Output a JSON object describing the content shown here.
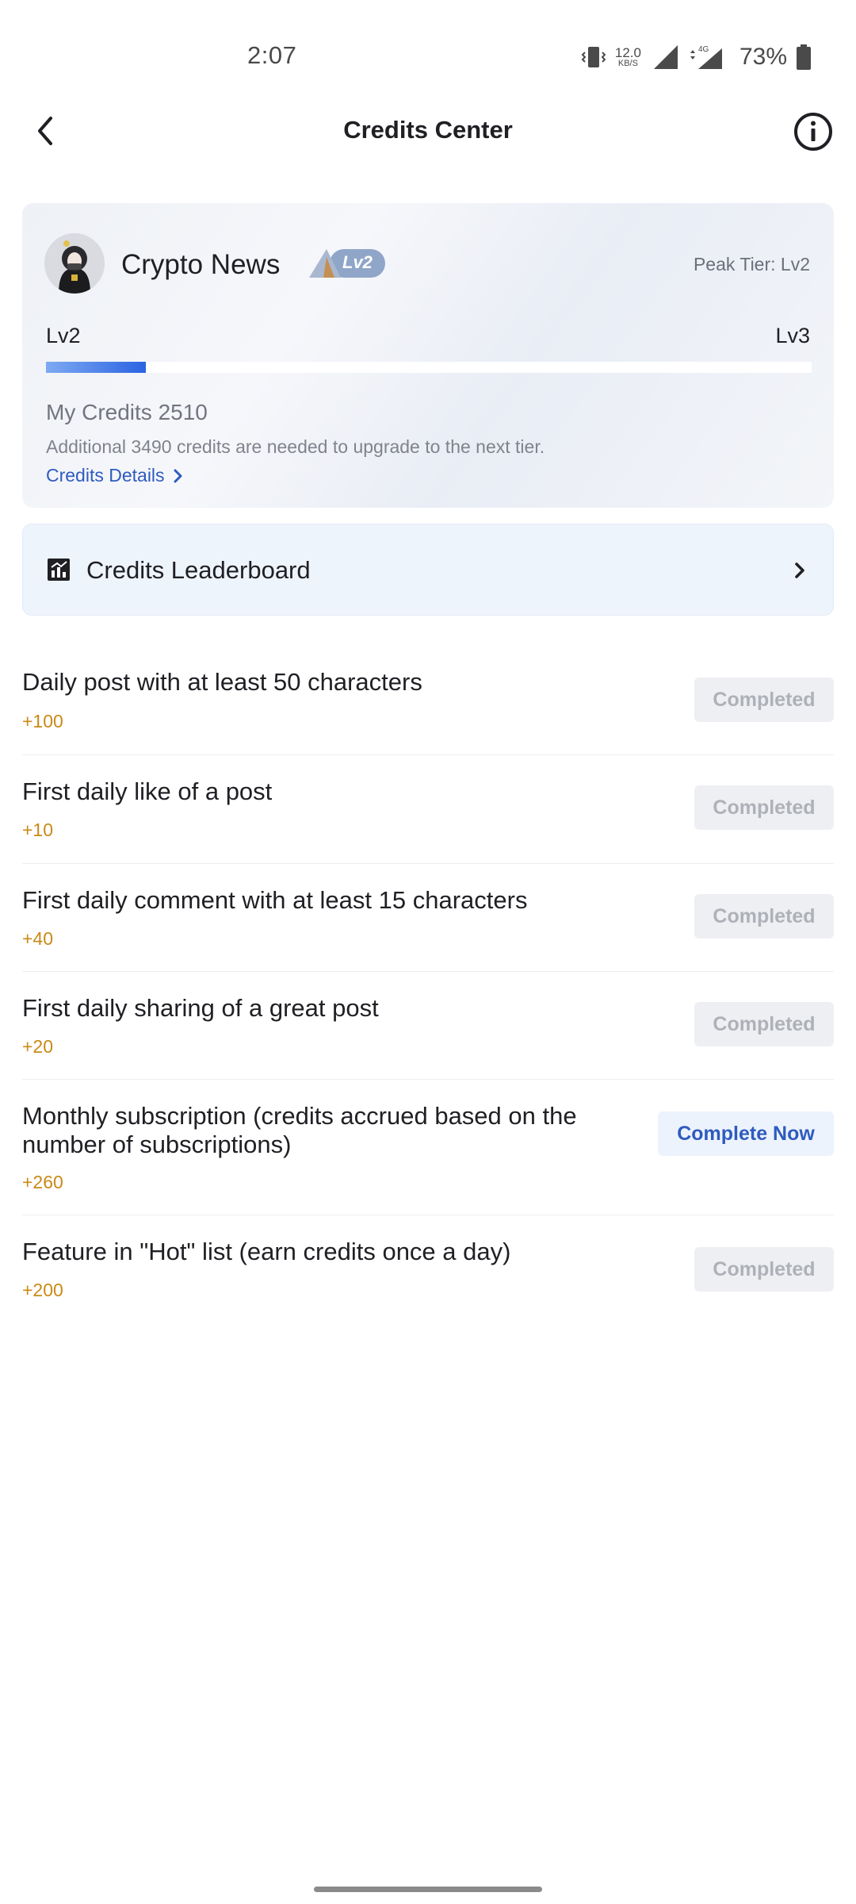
{
  "status_bar": {
    "time": "2:07",
    "net_speed_value": "12.0",
    "net_speed_unit": "KB/S",
    "network_type": "4G",
    "battery_percent": "73%"
  },
  "header": {
    "title": "Credits Center"
  },
  "profile": {
    "username": "Crypto News",
    "level_badge": "Lv2",
    "peak_tier": "Peak Tier: Lv2",
    "current_level": "Lv2",
    "next_level": "Lv3",
    "progress_fraction": 0.13,
    "my_credits": "My Credits 2510",
    "needed_text": "Additional 3490 credits are needed to upgrade to the next tier.",
    "details_link": "Credits Details"
  },
  "leaderboard": {
    "label": "Credits Leaderboard"
  },
  "tasks": [
    {
      "title": "Daily post with at least 50 characters",
      "points": "+100",
      "button": "Completed",
      "state": "completed"
    },
    {
      "title": "First daily like of a post",
      "points": "+10",
      "button": "Completed",
      "state": "completed"
    },
    {
      "title": "First daily comment with at least 15 characters",
      "points": "+40",
      "button": "Completed",
      "state": "completed"
    },
    {
      "title": "First daily sharing of a great post",
      "points": "+20",
      "button": "Completed",
      "state": "completed"
    },
    {
      "title": "Monthly subscription (credits accrued based on the number of subscriptions)",
      "points": "+260",
      "button": "Complete Now",
      "state": "action"
    },
    {
      "title": "Feature in \"Hot\" list (earn credits once a day)",
      "points": "+200",
      "button": "Completed",
      "state": "completed"
    }
  ],
  "colors": {
    "accent": "#2e5bbf",
    "points": "#c98a17",
    "progress_start": "#7eaaf2",
    "progress_end": "#2b63e2",
    "completed_bg": "#eeeff2",
    "completed_text": "#aeb1b8"
  }
}
